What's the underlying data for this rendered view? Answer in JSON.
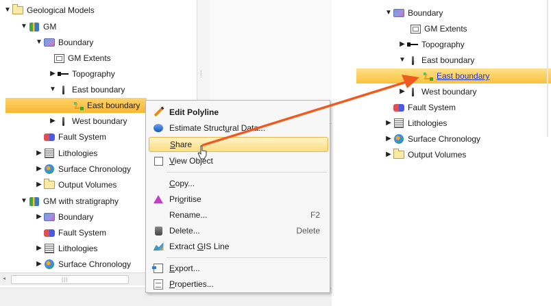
{
  "left_tree": {
    "items": [
      {
        "label": "Geological Models"
      },
      {
        "label": "GM"
      },
      {
        "label": "Boundary"
      },
      {
        "label": "GM Extents"
      },
      {
        "label": "Topography"
      },
      {
        "label": "East boundary"
      },
      {
        "label": "East boundary"
      },
      {
        "label": "West boundary"
      },
      {
        "label": "Fault System"
      },
      {
        "label": "Lithologies"
      },
      {
        "label": "Surface Chronology"
      },
      {
        "label": "Output Volumes"
      },
      {
        "label": "GM with stratigraphy"
      },
      {
        "label": "Boundary"
      },
      {
        "label": "Fault System"
      },
      {
        "label": "Lithologies"
      },
      {
        "label": "Surface Chronology"
      }
    ]
  },
  "context_menu": {
    "items": [
      {
        "label": "Edit Polyline",
        "shortcut": ""
      },
      {
        "label_pre": "Estimate Struct",
        "label_acc": "u",
        "label_post": "ral Data...",
        "shortcut": ""
      },
      {
        "label_acc": "S",
        "label_post": "hare",
        "shortcut": ""
      },
      {
        "label_acc": "V",
        "label_post": "iew Object",
        "shortcut": ""
      },
      {
        "label_acc": "C",
        "label_post": "opy...",
        "shortcut": ""
      },
      {
        "label_pre": "Pri",
        "label_acc": "o",
        "label_post": "ritise",
        "shortcut": ""
      },
      {
        "label": "Rename...",
        "shortcut": "F2"
      },
      {
        "label": "Delete...",
        "shortcut": "Delete"
      },
      {
        "label_pre": "Extract ",
        "label_acc": "G",
        "label_post": "IS Line",
        "shortcut": ""
      },
      {
        "label_acc": "E",
        "label_post": "xport...",
        "shortcut": ""
      },
      {
        "label_acc": "P",
        "label_post": "roperties...",
        "shortcut": ""
      }
    ]
  },
  "right_tree": {
    "items": [
      {
        "label": "Boundary"
      },
      {
        "label": "GM Extents"
      },
      {
        "label": "Topography"
      },
      {
        "label": "East boundary"
      },
      {
        "label": "East boundary"
      },
      {
        "label": "West boundary"
      },
      {
        "label": "Fault System"
      },
      {
        "label": "Lithologies"
      },
      {
        "label": "Surface Chronology"
      },
      {
        "label": "Output Volumes"
      }
    ]
  },
  "colors": {
    "selection": "#f7b733",
    "arrow": "#f05a1e",
    "link": "#1a36d8",
    "menu_hover": "#fbdf83"
  }
}
